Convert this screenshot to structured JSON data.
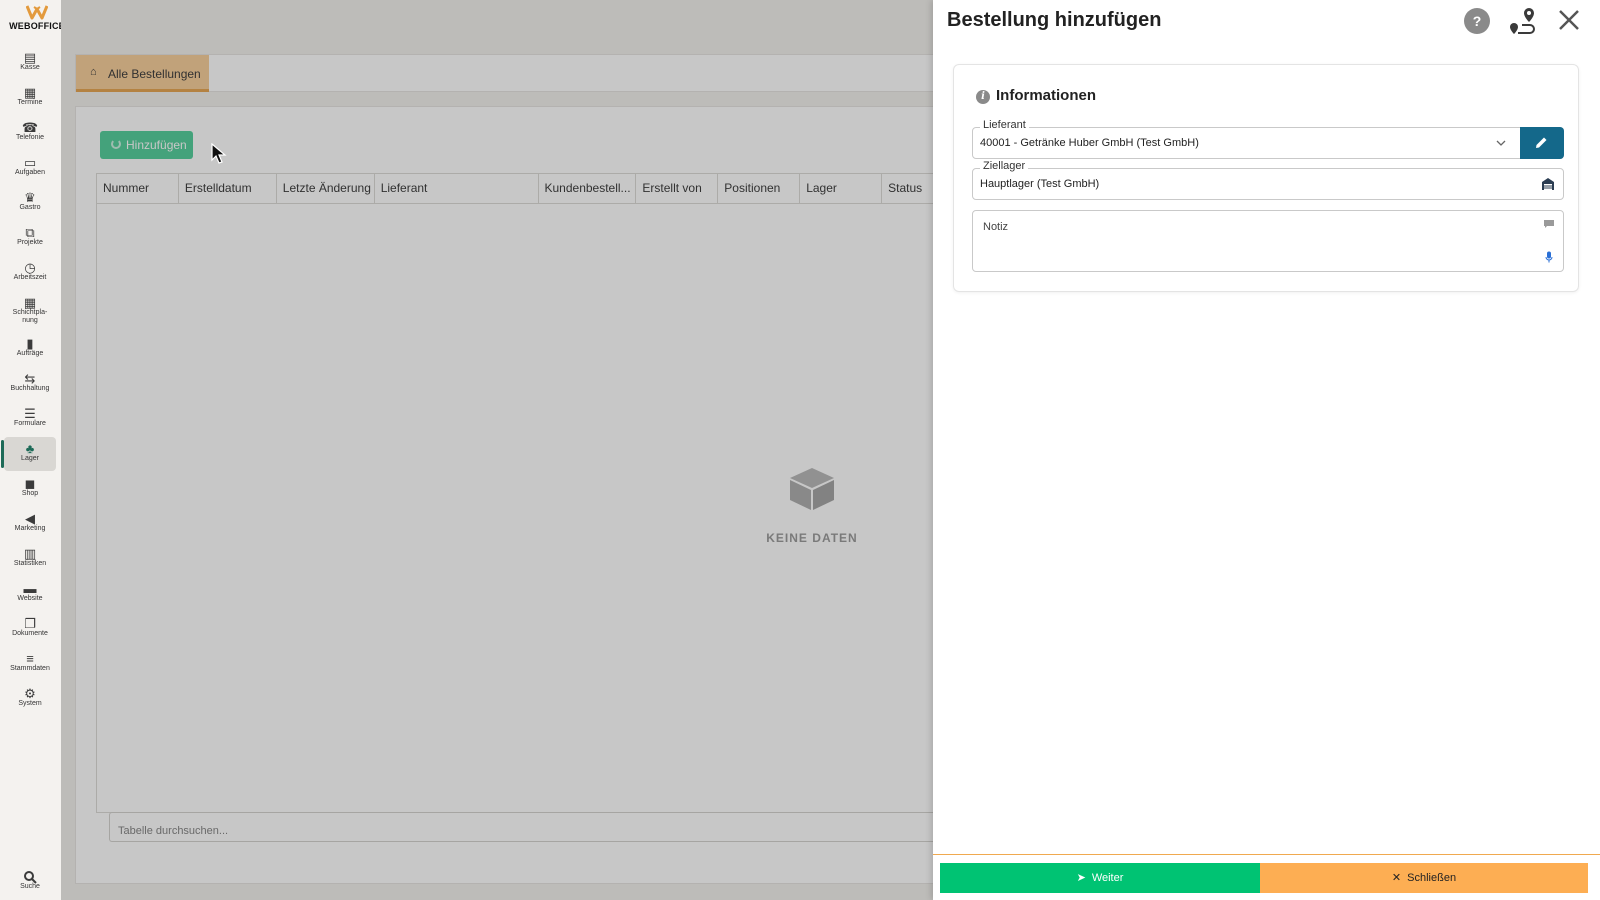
{
  "app": {
    "logo_text": "WEBOFFICE",
    "brand_color": "#e39a3c"
  },
  "sidebar": {
    "items": [
      {
        "label": "Kasse",
        "icon": "cash-register-icon"
      },
      {
        "label": "Termine",
        "icon": "calendar-icon"
      },
      {
        "label": "Telefonie",
        "icon": "phone-icon"
      },
      {
        "label": "Aufgaben",
        "icon": "tasks-icon"
      },
      {
        "label": "Gastro",
        "icon": "crown-icon"
      },
      {
        "label": "Projekte",
        "icon": "project-icon"
      },
      {
        "label": "Arbeitszeit",
        "icon": "clock-icon"
      },
      {
        "label": "Schichtpla-",
        "label2": "nung",
        "icon": "shift-plan-icon"
      },
      {
        "label": "Aufträge",
        "icon": "document-icon"
      },
      {
        "label": "Buchhaltung",
        "icon": "arrows-icon"
      },
      {
        "label": "Formulare",
        "icon": "list-icon"
      },
      {
        "label": "Lager",
        "icon": "boxes-icon",
        "active": true
      },
      {
        "label": "Shop",
        "icon": "bag-icon"
      },
      {
        "label": "Marketing",
        "icon": "megaphone-icon"
      },
      {
        "label": "Statistiken",
        "icon": "chart-icon"
      },
      {
        "label": "Website",
        "icon": "website-icon"
      },
      {
        "label": "Dokumente",
        "icon": "files-icon"
      },
      {
        "label": "Stammdaten",
        "icon": "database-icon"
      },
      {
        "label": "System",
        "icon": "gears-icon"
      }
    ],
    "search_label": "Suche"
  },
  "main": {
    "tab_label": "Alle Bestellungen",
    "add_button_label": "Hinzufügen",
    "columns": [
      "Nummer",
      "Erstelldatum",
      "Letzte Änderung",
      "Lieferant",
      "Kundenbestell...",
      "Erstellt von",
      "Positionen",
      "Lager",
      "Status"
    ],
    "empty_text": "KEINE DATEN",
    "search_placeholder": "Tabelle durchsuchen..."
  },
  "drawer": {
    "title": "Bestellung hinzufügen",
    "help_label": "?",
    "section_title": "Informationen",
    "lieferant": {
      "label": "Lieferant",
      "value": "40001 - Getränke Huber GmbH (Test GmbH)"
    },
    "ziellager": {
      "label": "Ziellager",
      "value": "Hauptlager (Test GmbH)"
    },
    "notiz": {
      "label": "Notiz"
    },
    "footer": {
      "next_label": "Weiter",
      "close_label": "Schließen"
    },
    "colors": {
      "next": "#00c373",
      "close": "#fdae53",
      "edit": "#14688a"
    }
  }
}
